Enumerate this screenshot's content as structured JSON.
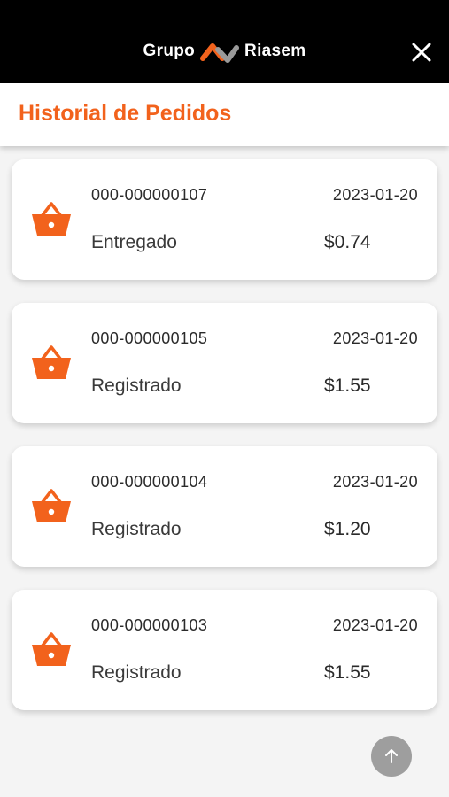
{
  "app": {
    "brand_left": "Grupo",
    "brand_right": "Riasem",
    "close_icon": "close-icon",
    "colors": {
      "topbar": "#000000",
      "accent": "#f2621c",
      "logo_gray": "#9a9a9a"
    }
  },
  "header": {
    "title": "Historial de Pedidos"
  },
  "orders": [
    {
      "number": "000-000000107",
      "date": "2023-01-20",
      "status": "Entregado",
      "total": "$0.74",
      "icon": "basket-icon"
    },
    {
      "number": "000-000000105",
      "date": "2023-01-20",
      "status": "Registrado",
      "total": "$1.55",
      "icon": "basket-icon"
    },
    {
      "number": "000-000000104",
      "date": "2023-01-20",
      "status": "Registrado",
      "total": "$1.20",
      "icon": "basket-icon"
    },
    {
      "number": "000-000000103",
      "date": "2023-01-20",
      "status": "Registrado",
      "total": "$1.55",
      "icon": "basket-icon"
    }
  ],
  "scroll_top": {
    "icon": "arrow-up-icon"
  }
}
